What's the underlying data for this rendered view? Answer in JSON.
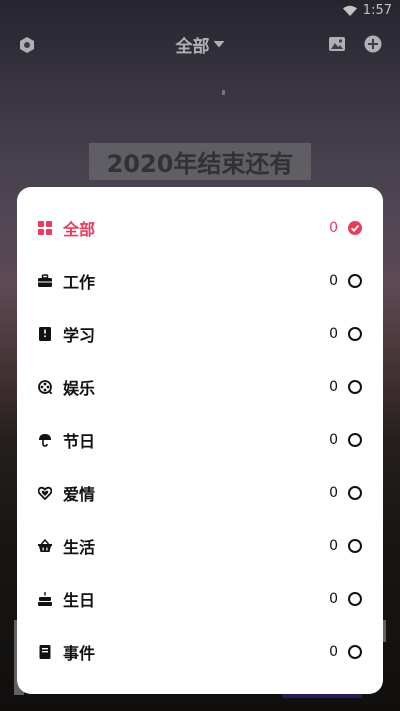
{
  "status_bar": {
    "time": "1:57",
    "icons": [
      "wifi-icon"
    ]
  },
  "top_bar": {
    "category_label": "全部",
    "icons": [
      "settings-icon",
      "chevron-down-icon",
      "image-icon",
      "add-icon"
    ]
  },
  "banner": {
    "title": "2020年结束还有"
  },
  "colors": {
    "accent": "#ea3b5b",
    "text": "#111111",
    "sheet_bg": "#ffffff"
  },
  "category_menu": {
    "items": [
      {
        "label": "全部",
        "count": "0",
        "icon": "grid-icon",
        "selected": true
      },
      {
        "label": "工作",
        "count": "0",
        "icon": "briefcase-icon",
        "selected": false
      },
      {
        "label": "学习",
        "count": "0",
        "icon": "book-icon",
        "selected": false
      },
      {
        "label": "娱乐",
        "count": "0",
        "icon": "film-reel-icon",
        "selected": false
      },
      {
        "label": "节日",
        "count": "0",
        "icon": "parasol-icon",
        "selected": false
      },
      {
        "label": "爱情",
        "count": "0",
        "icon": "heart-icon",
        "selected": false
      },
      {
        "label": "生活",
        "count": "0",
        "icon": "basket-icon",
        "selected": false
      },
      {
        "label": "生日",
        "count": "0",
        "icon": "cake-icon",
        "selected": false
      },
      {
        "label": "事件",
        "count": "0",
        "icon": "notebook-icon",
        "selected": false
      }
    ]
  }
}
